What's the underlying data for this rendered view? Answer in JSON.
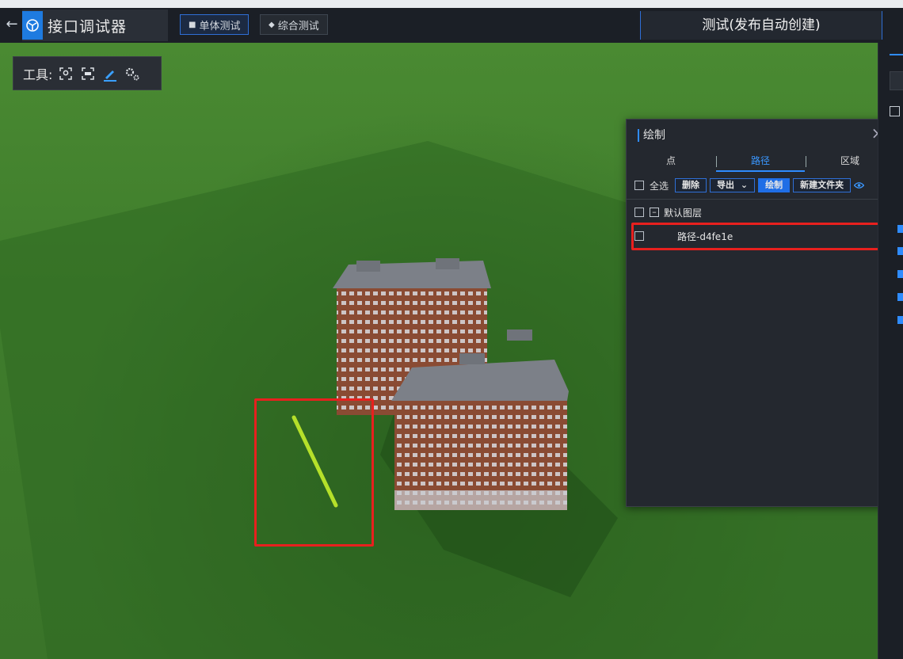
{
  "header": {
    "back_icon": "arrow-left-icon",
    "app_title": "接口调试器",
    "tabs": [
      {
        "label": "单体测试",
        "icon": "cube-icon",
        "active": true
      },
      {
        "label": "综合测试",
        "icon": "layers-icon",
        "active": false
      }
    ],
    "scene_title": "测试(发布自动创建)"
  },
  "toolbox": {
    "label": "工具:",
    "tools": [
      "location-icon",
      "measure-icon",
      "pencil-icon",
      "gears-icon"
    ]
  },
  "draw_panel": {
    "title": "绘制",
    "tabs": [
      {
        "label": "点",
        "active": false
      },
      {
        "label": "路径",
        "active": true
      },
      {
        "label": "区域",
        "active": false
      }
    ],
    "select_all_label": "全选",
    "buttons": {
      "delete": "删除",
      "export": "导出",
      "draw": "绘制",
      "new_folder": "新建文件夹"
    },
    "layers": [
      {
        "name": "默认图层",
        "items": [
          {
            "name": "路径-d4fe1e"
          }
        ]
      }
    ]
  },
  "colors": {
    "accent": "#2f8cff",
    "highlight_red": "#e8201e",
    "path_line": "#b5e02a"
  }
}
